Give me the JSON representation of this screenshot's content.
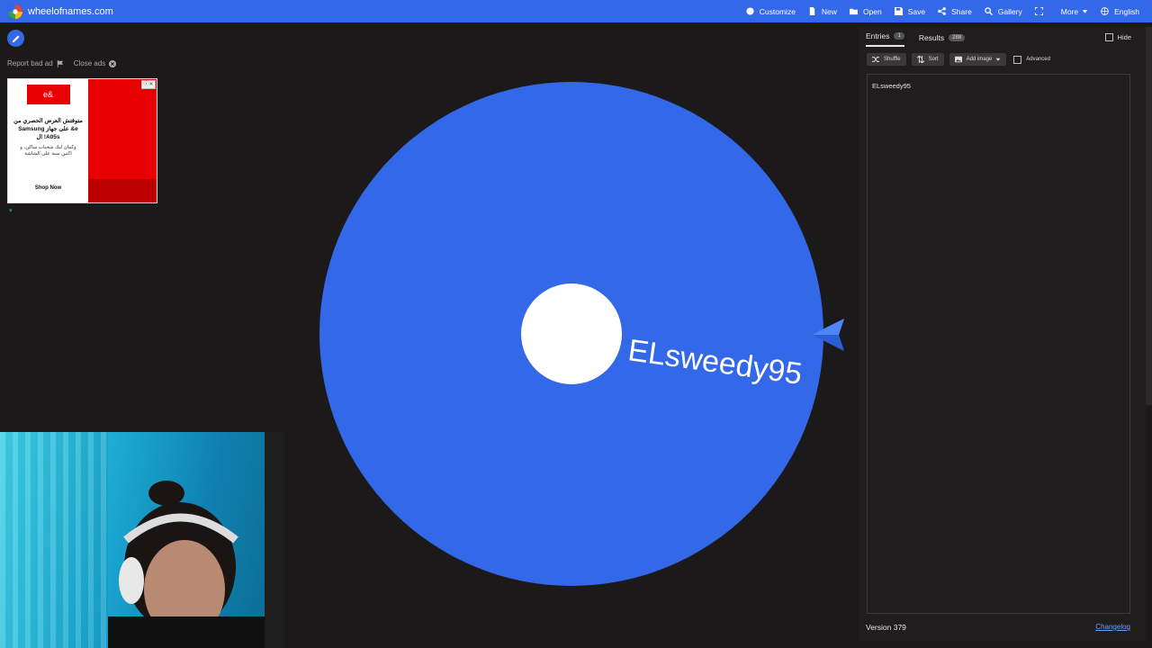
{
  "app": {
    "site": "wheelofnames.com"
  },
  "nav": {
    "items": [
      {
        "label": "Customize",
        "icon": "palette-icon"
      },
      {
        "label": "New",
        "icon": "file-icon"
      },
      {
        "label": "Open",
        "icon": "folder-icon"
      },
      {
        "label": "Save",
        "icon": "save-icon"
      },
      {
        "label": "Share",
        "icon": "share-icon"
      },
      {
        "label": "Gallery",
        "icon": "search-icon"
      },
      {
        "label": "",
        "icon": "fullscreen-icon"
      },
      {
        "label": "More",
        "icon": "chevron-down-icon"
      },
      {
        "label": "English",
        "icon": "globe-icon"
      }
    ]
  },
  "ads": {
    "report_label": "Report bad ad",
    "close_label": "Close ads",
    "logo_text": "e&",
    "title": "متوفتش العرض الحصري من e& على جهاز Samsung A05s! ال",
    "subtitle": "وكمان ليك شحنات ساكن، و اكتين سنة على الشاشة",
    "cta": "Shop Now"
  },
  "wheel": {
    "entries": [
      "ELsweedy95"
    ],
    "color": "#3369e8",
    "center_color": "#ffffff",
    "rotation_deg": 8
  },
  "panel": {
    "tabs": [
      {
        "label": "Entries",
        "count": "1",
        "active": true
      },
      {
        "label": "Results",
        "count": "288",
        "active": false
      }
    ],
    "hide_label": "Hide",
    "toolbar": {
      "shuffle": "Shuffle",
      "sort": "Sort",
      "add_image": "Add image",
      "advanced": "Advanced"
    },
    "entries_text": "ELsweedy95",
    "version": "Version 379",
    "changelog": "Changelog"
  }
}
